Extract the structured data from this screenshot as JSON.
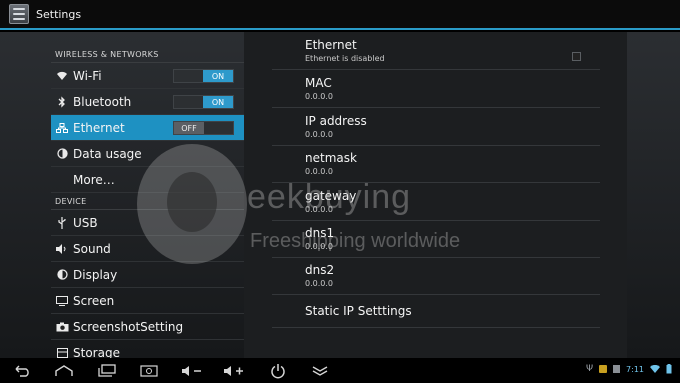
{
  "app": {
    "title": "Settings",
    "icon": "settings-sliders-icon"
  },
  "accent": "#1e91c2",
  "left": {
    "section_wireless": "WIRELESS & NETWORKS",
    "section_device": "DEVICE",
    "items": [
      {
        "label": "Wi-Fi",
        "icon": "wifi-icon",
        "toggle": "ON"
      },
      {
        "label": "Bluetooth",
        "icon": "bluetooth-icon",
        "toggle": "ON"
      },
      {
        "label": "Ethernet",
        "icon": "ethernet-icon",
        "toggle": "OFF",
        "selected": true
      },
      {
        "label": "Data usage",
        "icon": "data-usage-icon"
      },
      {
        "label": "More…"
      },
      {
        "label": "USB",
        "icon": "usb-icon"
      },
      {
        "label": "Sound",
        "icon": "sound-icon"
      },
      {
        "label": "Display",
        "icon": "display-icon"
      },
      {
        "label": "Screen",
        "icon": "screen-icon"
      },
      {
        "label": "ScreenshotSetting",
        "icon": "camera-icon"
      },
      {
        "label": "Storage",
        "icon": "storage-icon"
      }
    ]
  },
  "right": {
    "ethernet": {
      "title": "Ethernet",
      "subtitle": "Ethernet is disabled"
    },
    "rows": [
      {
        "title": "MAC",
        "value": "0.0.0.0"
      },
      {
        "title": "IP address",
        "value": "0.0.0.0"
      },
      {
        "title": "netmask",
        "value": "0.0.0.0"
      },
      {
        "title": "gateway",
        "value": "0.0.0.0"
      },
      {
        "title": "dns1",
        "value": "0.0.0.0"
      },
      {
        "title": "dns2",
        "value": "0.0.0.0"
      }
    ],
    "static_ip": "Static IP Setttings"
  },
  "watermark": {
    "brand": "eekbuying",
    "tagline": "Freeshipping worldwide"
  },
  "status": {
    "time": "7:11"
  }
}
